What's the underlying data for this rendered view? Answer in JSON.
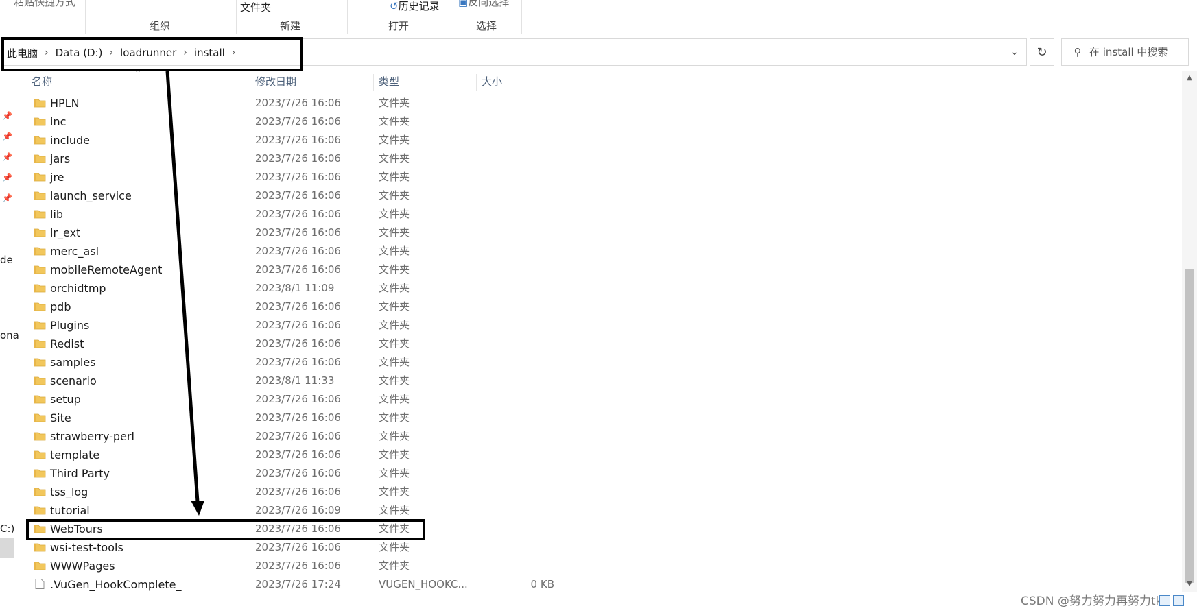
{
  "ribbon": {
    "top_left_fragment": "粘贴快捷方式",
    "new_folder_label": "文件夹",
    "history_label": "历史记录",
    "select_fragment": "反向选择",
    "groups": [
      "组织",
      "新建",
      "打开",
      "选择"
    ]
  },
  "address": {
    "crumbs": [
      "此电脑",
      "Data (D:)",
      "loadrunner",
      "install"
    ],
    "search_placeholder": "在 install 中搜索"
  },
  "nav": {
    "fragments": [
      "de",
      "ona",
      "C:)"
    ]
  },
  "columns": {
    "name": "名称",
    "date": "修改日期",
    "type": "类型",
    "size": "大小"
  },
  "files": [
    {
      "name": "HPLN",
      "date": "2023/7/26 16:06",
      "type": "文件夹",
      "size": "",
      "kind": "folder"
    },
    {
      "name": "inc",
      "date": "2023/7/26 16:06",
      "type": "文件夹",
      "size": "",
      "kind": "folder"
    },
    {
      "name": "include",
      "date": "2023/7/26 16:06",
      "type": "文件夹",
      "size": "",
      "kind": "folder"
    },
    {
      "name": "jars",
      "date": "2023/7/26 16:06",
      "type": "文件夹",
      "size": "",
      "kind": "folder"
    },
    {
      "name": "jre",
      "date": "2023/7/26 16:06",
      "type": "文件夹",
      "size": "",
      "kind": "folder"
    },
    {
      "name": "launch_service",
      "date": "2023/7/26 16:06",
      "type": "文件夹",
      "size": "",
      "kind": "folder"
    },
    {
      "name": "lib",
      "date": "2023/7/26 16:06",
      "type": "文件夹",
      "size": "",
      "kind": "folder"
    },
    {
      "name": "lr_ext",
      "date": "2023/7/26 16:06",
      "type": "文件夹",
      "size": "",
      "kind": "folder"
    },
    {
      "name": "merc_asl",
      "date": "2023/7/26 16:06",
      "type": "文件夹",
      "size": "",
      "kind": "folder"
    },
    {
      "name": "mobileRemoteAgent",
      "date": "2023/7/26 16:06",
      "type": "文件夹",
      "size": "",
      "kind": "folder"
    },
    {
      "name": "orchidtmp",
      "date": "2023/8/1 11:09",
      "type": "文件夹",
      "size": "",
      "kind": "folder"
    },
    {
      "name": "pdb",
      "date": "2023/7/26 16:06",
      "type": "文件夹",
      "size": "",
      "kind": "folder"
    },
    {
      "name": "Plugins",
      "date": "2023/7/26 16:06",
      "type": "文件夹",
      "size": "",
      "kind": "folder"
    },
    {
      "name": "Redist",
      "date": "2023/7/26 16:06",
      "type": "文件夹",
      "size": "",
      "kind": "folder"
    },
    {
      "name": "samples",
      "date": "2023/7/26 16:06",
      "type": "文件夹",
      "size": "",
      "kind": "folder"
    },
    {
      "name": "scenario",
      "date": "2023/8/1 11:33",
      "type": "文件夹",
      "size": "",
      "kind": "folder"
    },
    {
      "name": "setup",
      "date": "2023/7/26 16:06",
      "type": "文件夹",
      "size": "",
      "kind": "folder"
    },
    {
      "name": "Site",
      "date": "2023/7/26 16:06",
      "type": "文件夹",
      "size": "",
      "kind": "folder"
    },
    {
      "name": "strawberry-perl",
      "date": "2023/7/26 16:06",
      "type": "文件夹",
      "size": "",
      "kind": "folder"
    },
    {
      "name": "template",
      "date": "2023/7/26 16:06",
      "type": "文件夹",
      "size": "",
      "kind": "folder"
    },
    {
      "name": "Third Party",
      "date": "2023/7/26 16:06",
      "type": "文件夹",
      "size": "",
      "kind": "folder"
    },
    {
      "name": "tss_log",
      "date": "2023/7/26 16:06",
      "type": "文件夹",
      "size": "",
      "kind": "folder"
    },
    {
      "name": "tutorial",
      "date": "2023/7/26 16:09",
      "type": "文件夹",
      "size": "",
      "kind": "folder"
    },
    {
      "name": "WebTours",
      "date": "2023/7/26 16:06",
      "type": "文件夹",
      "size": "",
      "kind": "folder"
    },
    {
      "name": "wsi-test-tools",
      "date": "2023/7/26 16:06",
      "type": "文件夹",
      "size": "",
      "kind": "folder"
    },
    {
      "name": "WWWPages",
      "date": "2023/7/26 16:06",
      "type": "文件夹",
      "size": "",
      "kind": "folder"
    },
    {
      "name": ".VuGen_HookComplete_",
      "date": "2023/7/26 17:24",
      "type": "VUGEN_HOOKC...",
      "size": "0 KB",
      "kind": "file"
    }
  ],
  "watermark": "CSDN @努力努力再努力tk",
  "annotation_color": "#000000",
  "folder_color": "#f2c75c"
}
